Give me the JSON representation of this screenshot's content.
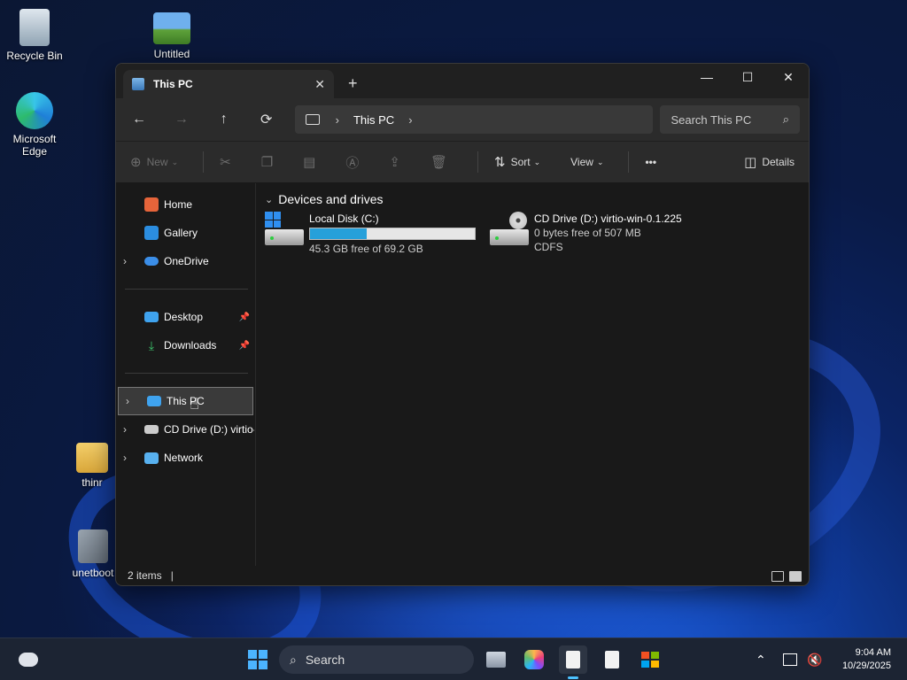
{
  "desktop": {
    "icons": [
      {
        "label": "Recycle Bin"
      },
      {
        "label": "Untitled"
      },
      {
        "label": "Microsoft Edge"
      },
      {
        "label": "thinr"
      },
      {
        "label": "unetboot"
      }
    ]
  },
  "window": {
    "tab_title": "This PC",
    "tab_close": "✕",
    "new_tab": "+",
    "controls": {
      "minimize": "—",
      "maximize": "☐",
      "close": "✕"
    },
    "nav": {
      "back": "←",
      "forward": "→",
      "up": "↑",
      "refresh": "⟳"
    },
    "address": {
      "separator": "›",
      "crumb": "This PC",
      "trailing": "›"
    },
    "search": {
      "placeholder": "Search This PC",
      "icon": "search-icon"
    },
    "commands": {
      "new_label": "New",
      "sort_label": "Sort",
      "view_label": "View",
      "more_label": "•••",
      "details_label": "Details"
    },
    "sidebar": {
      "items": [
        {
          "label": "Home",
          "color": "#e6643a"
        },
        {
          "label": "Gallery",
          "color": "#2b8de0"
        },
        {
          "label": "OneDrive",
          "color": "#3b8ee8"
        },
        {
          "label": "Desktop",
          "color": "#3fa3ef"
        },
        {
          "label": "Downloads",
          "color": "#3ec46d"
        },
        {
          "label": "This PC",
          "color": "#3fa3ef"
        },
        {
          "label": "CD Drive (D:) virtio-",
          "color": "#cccccc"
        },
        {
          "label": "Network",
          "color": "#58b1f0"
        }
      ],
      "pin": "📌"
    },
    "group_header": "Devices and drives",
    "drives": [
      {
        "name": "Local Disk (C:)",
        "free_text": "45.3 GB free of 69.2 GB",
        "used_fraction": 0.345
      },
      {
        "name": "CD Drive (D:) virtio-win-0.1.225",
        "free_text": "0 bytes free of 507 MB",
        "fs": "CDFS"
      }
    ],
    "status": {
      "items": "2 items",
      "caret": "|"
    }
  },
  "taskbar": {
    "search_label": "Search",
    "clock_time": "9:04 AM",
    "clock_date": "10/29/2025"
  }
}
